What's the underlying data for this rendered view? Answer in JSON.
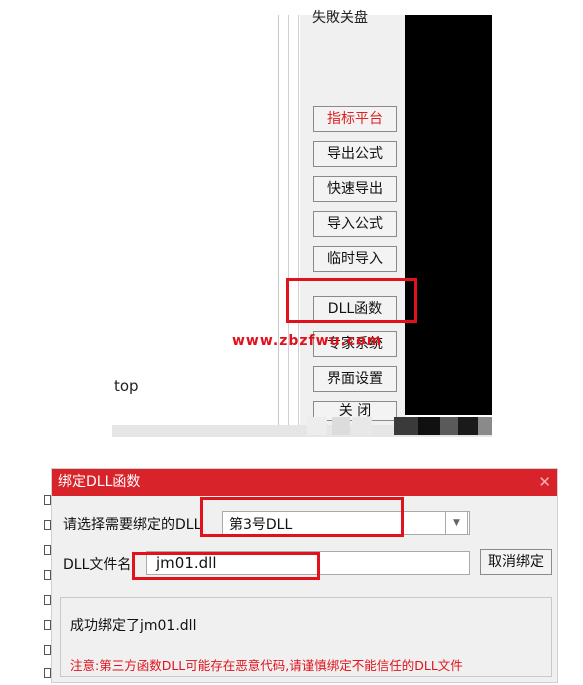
{
  "top_panel": {
    "cut_text": "失敗关盘",
    "buttons": [
      {
        "label": "指标平台",
        "color": "#e02020"
      },
      {
        "label": "导出公式"
      },
      {
        "label": "快速导出"
      },
      {
        "label": "导入公式"
      },
      {
        "label": "临时导入"
      },
      {
        "label": "DLL函数"
      },
      {
        "label": "专家系统"
      },
      {
        "label": "界面设置"
      },
      {
        "label": "关 闭"
      }
    ],
    "watermark": "www.zbzfwu.com",
    "left_text": "top"
  },
  "dialog": {
    "title": "绑定DLL函数",
    "close_glyph": "✕",
    "select_label": "请选择需要绑定的DLL",
    "selected_dll": "第3号DLL",
    "file_label": "DLL文件名",
    "file_value": "jm01.dll",
    "unbind_label": "取消绑定",
    "status": "成功绑定了jm01.dll",
    "warning": "注意:第三方函数DLL可能存在恶意代码,请谨慎绑定不能信任的DLL文件"
  },
  "colors": {
    "highlight": "#e1121c",
    "title_bar": "#d8232a"
  }
}
